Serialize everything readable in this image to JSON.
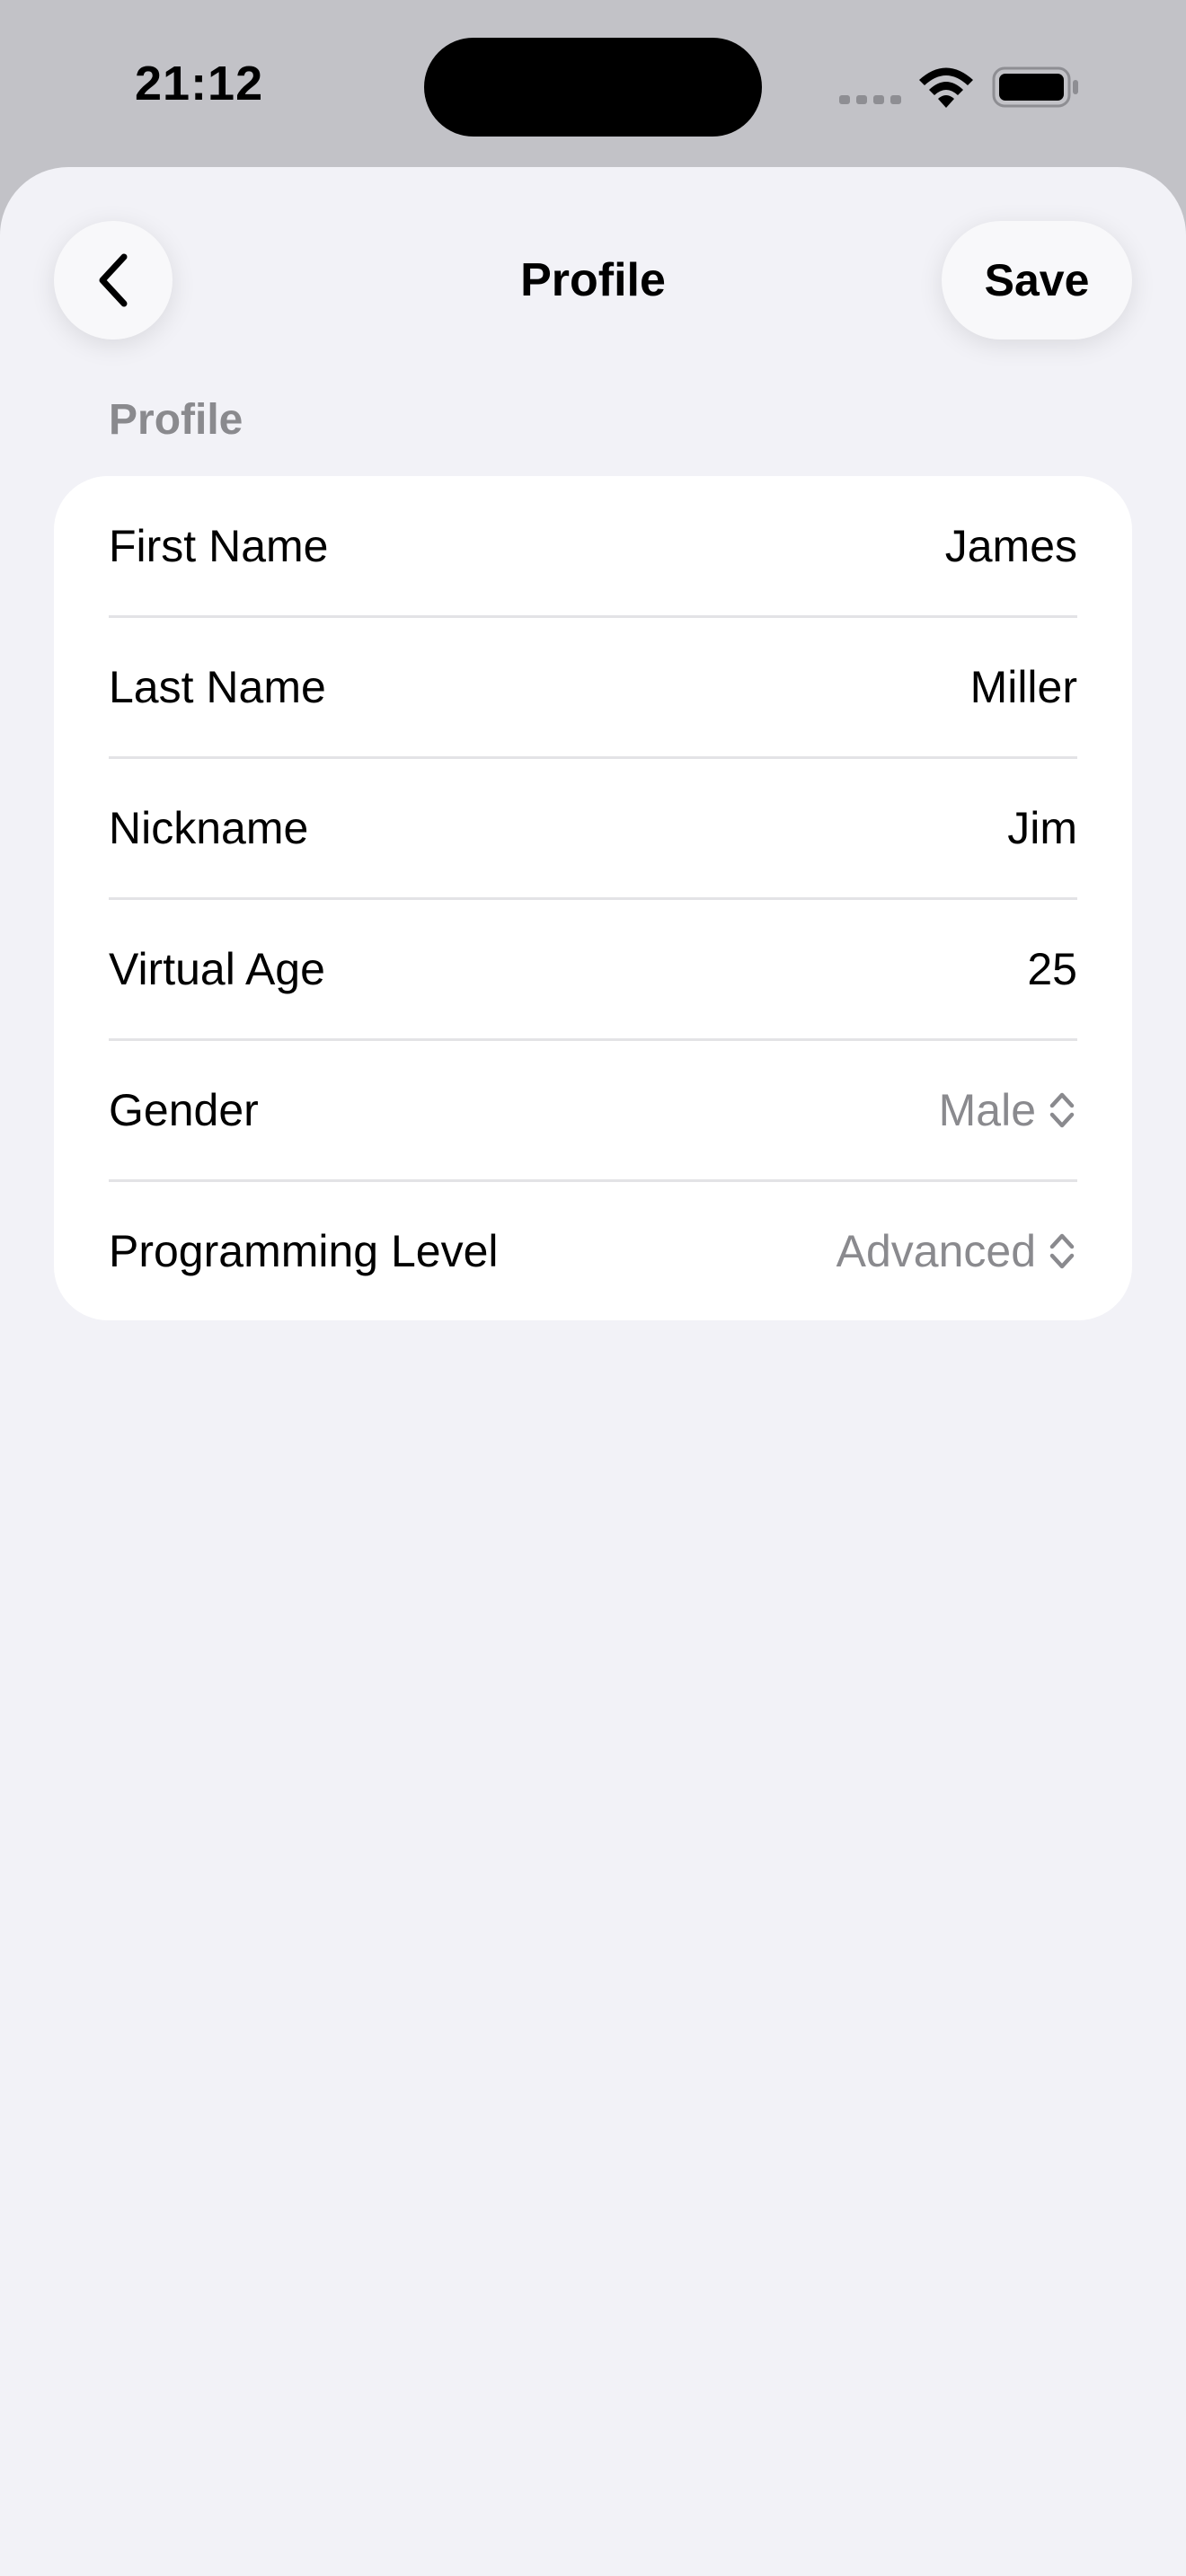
{
  "status_bar": {
    "time": "21:12"
  },
  "nav": {
    "title": "Profile",
    "save_label": "Save"
  },
  "section": {
    "header": "Profile"
  },
  "rows": [
    {
      "label": "First Name",
      "value": "James"
    },
    {
      "label": "Last Name",
      "value": "Miller"
    },
    {
      "label": "Nickname",
      "value": "Jim"
    },
    {
      "label": "Virtual Age",
      "value": "25"
    },
    {
      "label": "Gender",
      "value": "Male"
    },
    {
      "label": "Programming Level",
      "value": "Advanced"
    }
  ],
  "icons": {
    "back": "chevron-left-icon",
    "picker": "chevron-up-down-icon",
    "signal": "cellular-signal-icon",
    "wifi": "wifi-icon",
    "battery": "battery-icon"
  },
  "colors": {
    "background": "#f2f2f7",
    "card": "#ffffff",
    "secondary_text": "#8a8a8e",
    "status_bar_bg": "#c2c2c7"
  }
}
